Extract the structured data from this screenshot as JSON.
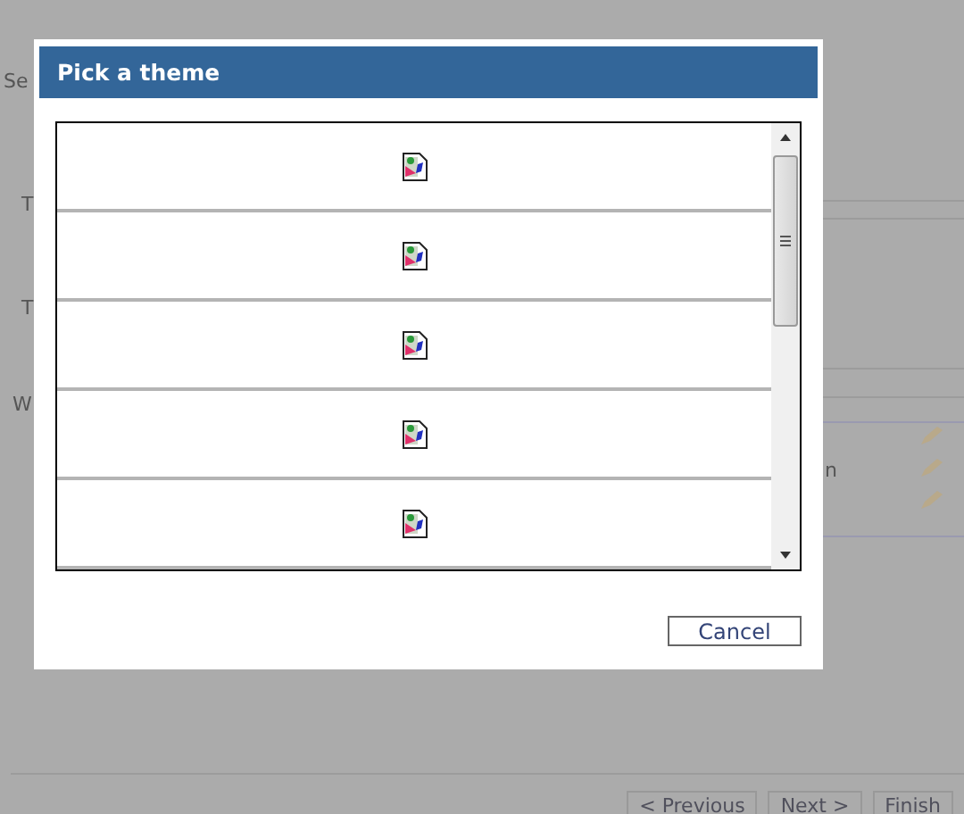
{
  "background": {
    "labels": [
      {
        "text": "Se"
      },
      {
        "text": "T"
      },
      {
        "text": "T"
      },
      {
        "text": "W"
      },
      {
        "text": "n"
      }
    ],
    "wizard_buttons": [
      {
        "label": "< Previous",
        "disabled": true
      },
      {
        "label": "Next >",
        "disabled": true
      },
      {
        "label": "Finish",
        "disabled": true
      }
    ]
  },
  "dialog": {
    "title": "Pick a theme",
    "themes": [
      {
        "kind": "broken_image"
      },
      {
        "kind": "broken_image"
      },
      {
        "kind": "broken_image"
      },
      {
        "kind": "broken_image"
      },
      {
        "kind": "broken_image"
      }
    ],
    "buttons": [
      "Cancel"
    ]
  }
}
